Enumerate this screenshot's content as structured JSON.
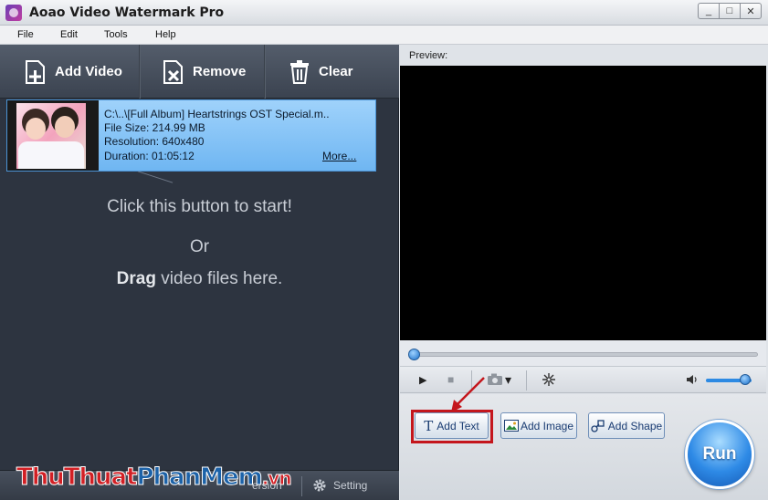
{
  "window": {
    "title": "Aoao Video Watermark Pro",
    "controls": [
      "_",
      "□",
      "✕"
    ]
  },
  "menu": [
    "File",
    "Edit",
    "Tools",
    "Help"
  ],
  "toolbar": {
    "add_video": "Add Video",
    "remove": "Remove",
    "clear": "Clear"
  },
  "video_item": {
    "path": "C:\\..\\[Full Album] Heartstrings OST Special.m..",
    "file_size": "File Size: 214.99 MB",
    "resolution": "Resolution: 640x480",
    "duration": "Duration: 01:05:12",
    "more": "More..."
  },
  "hint": {
    "start": "Click this button to start!",
    "or": "Or",
    "drag_bold": "Drag",
    "drag_rest": " video files here."
  },
  "left_bottom": {
    "version": "ersion",
    "setting": "Setting"
  },
  "watermark": {
    "part1": "ThuThuat",
    "part2": "PhanMem",
    "part3": ".vn"
  },
  "preview": {
    "label": "Preview:",
    "progress": 0
  },
  "player": {
    "play": "▶",
    "stop": "■",
    "snapshot_dropdown": "▾",
    "volume_level": 0.85
  },
  "actions": {
    "add_text": "Add Text",
    "add_image": "Add Image",
    "add_shape": "Add Shape",
    "run": "Run"
  },
  "colors": {
    "highlight": "#c4161c",
    "accent": "#2e8ae6",
    "left_panel_bg": "#2d3440"
  }
}
